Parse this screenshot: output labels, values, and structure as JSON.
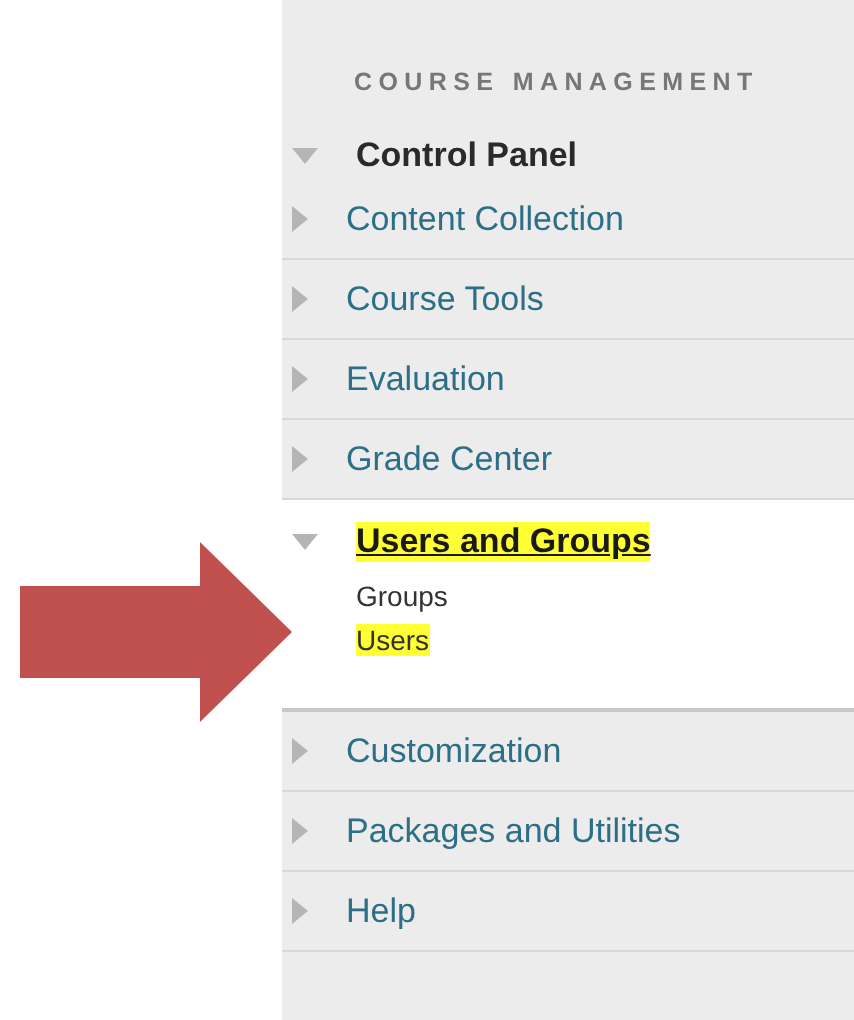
{
  "section_heading": "COURSE MANAGEMENT",
  "control_panel": {
    "label": "Control Panel",
    "expanded": true,
    "items": [
      {
        "label": "Content Collection",
        "expanded": false,
        "highlighted": false
      },
      {
        "label": "Course Tools",
        "expanded": false,
        "highlighted": false
      },
      {
        "label": "Evaluation",
        "expanded": false,
        "highlighted": false
      },
      {
        "label": "Grade Center",
        "expanded": false,
        "highlighted": false
      },
      {
        "label": "Users and Groups",
        "expanded": true,
        "highlighted": true,
        "children": [
          {
            "label": "Groups",
            "highlighted": false
          },
          {
            "label": "Users",
            "highlighted": true
          }
        ]
      },
      {
        "label": "Customization",
        "expanded": false,
        "highlighted": false
      },
      {
        "label": "Packages and Utilities",
        "expanded": false,
        "highlighted": false
      },
      {
        "label": "Help",
        "expanded": false,
        "highlighted": false
      }
    ]
  },
  "annotation": {
    "kind": "arrow"
  }
}
